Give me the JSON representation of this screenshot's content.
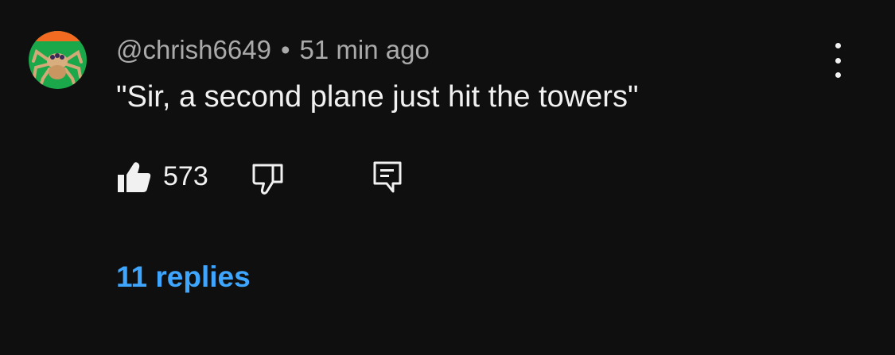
{
  "comment": {
    "author": "@chrish6649",
    "separator": "•",
    "timestamp": "51 min ago",
    "text": "\"Sir, a second plane just hit the towers\"",
    "like_count": "573",
    "replies_label": "11 replies"
  },
  "icons": {
    "avatar": "spider-avatar",
    "like": "thumbs-up-icon",
    "dislike": "thumbs-down-icon",
    "reply": "reply-comment-icon",
    "more": "more-vertical-icon"
  },
  "colors": {
    "background": "#0f0f0f",
    "text_primary": "#f1f1f1",
    "text_secondary": "#aaaaaa",
    "link": "#3ea6ff",
    "avatar_orange": "#f36b21",
    "avatar_green": "#1aa84a"
  }
}
